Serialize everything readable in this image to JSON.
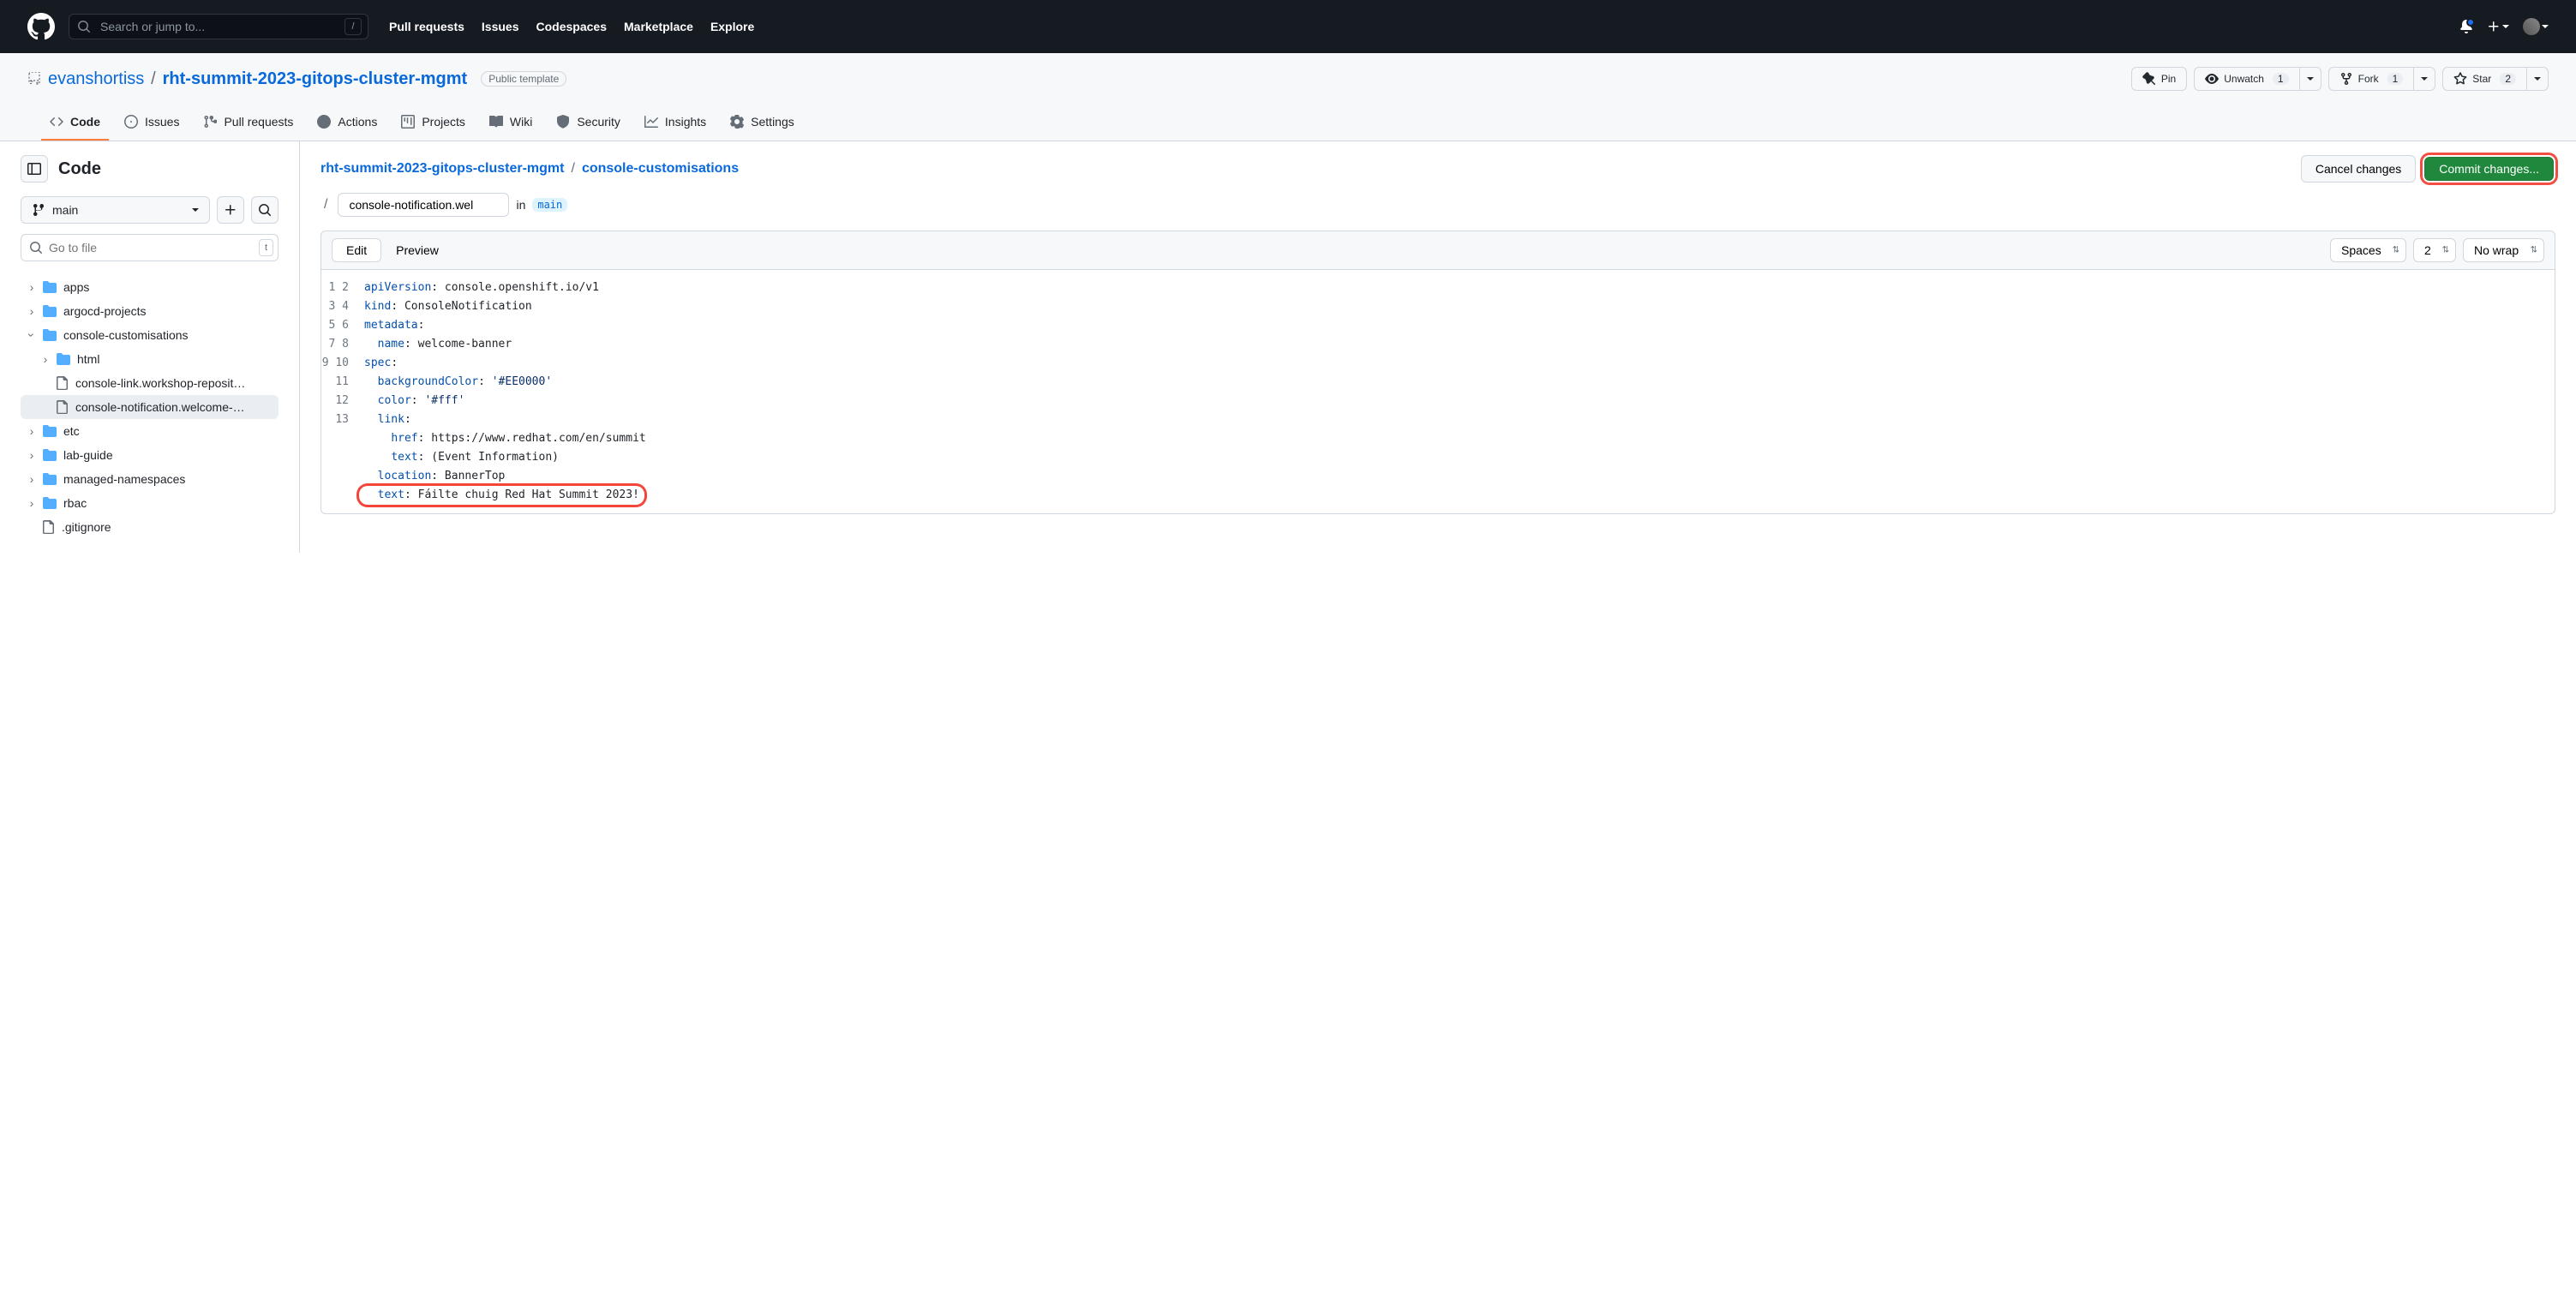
{
  "header": {
    "search_placeholder": "Search or jump to...",
    "nav": [
      "Pull requests",
      "Issues",
      "Codespaces",
      "Marketplace",
      "Explore"
    ]
  },
  "repo": {
    "owner": "evanshortiss",
    "name": "rht-summit-2023-gitops-cluster-mgmt",
    "template_label": "Public template",
    "actions": {
      "pin": "Pin",
      "unwatch": "Unwatch",
      "unwatch_count": "1",
      "fork": "Fork",
      "fork_count": "1",
      "star": "Star",
      "star_count": "2"
    }
  },
  "tabs": [
    "Code",
    "Issues",
    "Pull requests",
    "Actions",
    "Projects",
    "Wiki",
    "Security",
    "Insights",
    "Settings"
  ],
  "sidebar": {
    "title": "Code",
    "branch": "main",
    "filter_placeholder": "Go to file",
    "filter_kbd": "t",
    "tree": {
      "apps": "apps",
      "argocd": "argocd-projects",
      "console": "console-customisations",
      "html": "html",
      "link": "console-link.workshop-reposit…",
      "notif": "console-notification.welcome-…",
      "etc": "etc",
      "lab": "lab-guide",
      "managed": "managed-namespaces",
      "rbac": "rbac",
      "gitignore": ".gitignore"
    }
  },
  "breadcrumb": {
    "root": "rht-summit-2023-gitops-cluster-mgmt",
    "folder": "console-customisations",
    "filename_value": "console-notification.wel",
    "in_word": "in",
    "branch": "main",
    "cancel": "Cancel changes",
    "commit": "Commit changes..."
  },
  "editor": {
    "edit_tab": "Edit",
    "preview_tab": "Preview",
    "indent": "Spaces",
    "indent_size": "2",
    "wrap": "No wrap",
    "code": {
      "l1_key": "apiVersion",
      "l1_val": ": console.openshift.io/v1",
      "l2_key": "kind",
      "l2_val": ": ConsoleNotification",
      "l3_key": "metadata",
      "l3_val": ":",
      "l4_key": "name",
      "l4_val": ": welcome-banner",
      "l5_key": "spec",
      "l5_val": ":",
      "l6_key": "backgroundColor",
      "l6_val_a": ": ",
      "l6_val_b": "'#EE0000'",
      "l7_key": "color",
      "l7_val_a": ": ",
      "l7_val_b": "'#fff'",
      "l8_key": "link",
      "l8_val": ":",
      "l9_key": "href",
      "l9_val": ": https://www.redhat.com/en/summit",
      "l10_key": "text",
      "l10_val": ": (Event Information)",
      "l11_key": "location",
      "l11_val": ": BannerTop",
      "l12_key": "text",
      "l12_val": ": Fáilte chuig Red Hat Summit 2023!"
    }
  }
}
